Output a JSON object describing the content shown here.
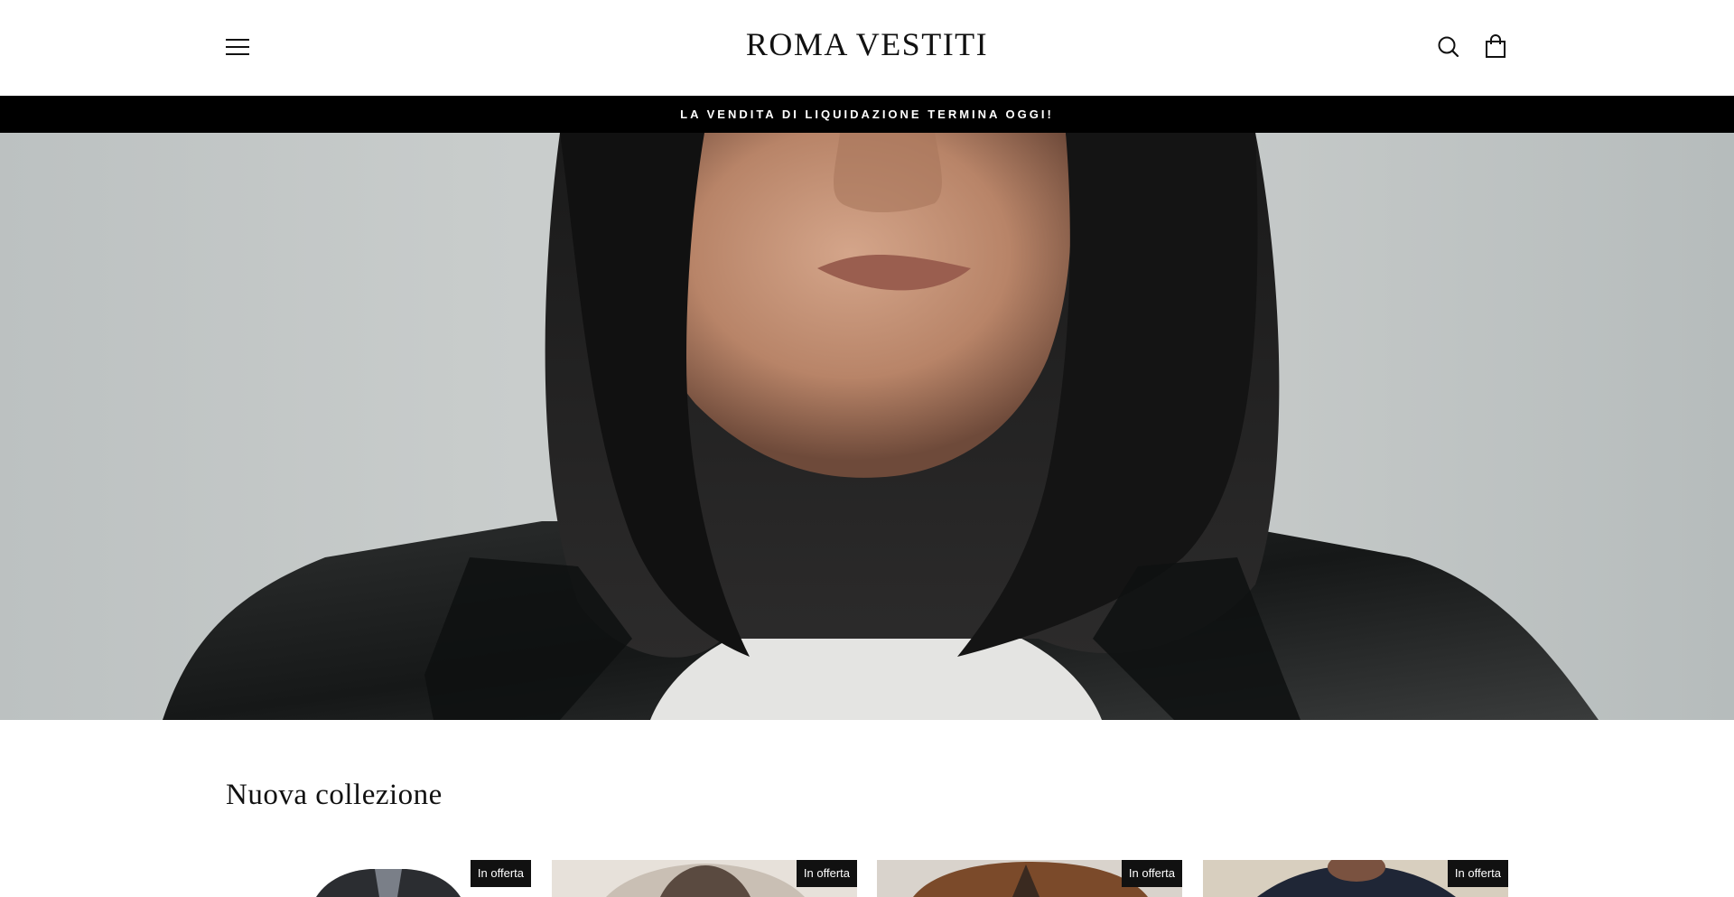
{
  "header": {
    "logo": "ROMA VESTITI",
    "menu_icon": "hamburger-menu-icon",
    "search_icon": "search-icon",
    "cart_icon": "shopping-bag-icon"
  },
  "announcement": {
    "text": "LA VENDITA DI LIQUIDAZIONE TERMINA OGGI!"
  },
  "hero": {
    "image": "woman-portrait-leather-jacket"
  },
  "collection": {
    "title": "Nuova collezione",
    "products": [
      {
        "badge": "In offerta",
        "image": "dark-blazer-product"
      },
      {
        "badge": "In offerta",
        "image": "light-jacket-model"
      },
      {
        "badge": "In offerta",
        "image": "brown-suede-jacket-model"
      },
      {
        "badge": "In offerta",
        "image": "navy-jacket-man"
      }
    ]
  },
  "colors": {
    "accent": "#000000",
    "background": "#ffffff"
  }
}
